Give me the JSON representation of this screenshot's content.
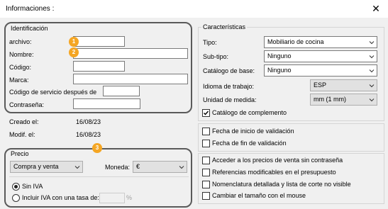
{
  "window": {
    "title": "Informaciones :"
  },
  "identificacion": {
    "legend": "Identificación",
    "fields": {
      "archivo": {
        "label": "archivo:",
        "value": ""
      },
      "nombre": {
        "label": "Nombre:",
        "value": ""
      },
      "codigo": {
        "label": "Código:",
        "value": ""
      },
      "marca": {
        "label": "Marca:",
        "value": ""
      },
      "codigo_servicio": {
        "label": "Código de servicio después de",
        "value": ""
      },
      "contrasena": {
        "label": "Contraseña:",
        "value": ""
      }
    }
  },
  "info": {
    "creado_label": "Creado el:",
    "creado_value": "16/08/23",
    "modif_label": "Modif. el:",
    "modif_value": "16/08/23"
  },
  "precio": {
    "legend": "Precio",
    "tipo_value": "Compra y venta",
    "moneda_label": "Moneda:",
    "moneda_value": "€",
    "sin_iva_label": "Sin IVA",
    "incluir_iva_label": "Incluir IVA con una tasa de:",
    "tasa_value": "",
    "percent": "%"
  },
  "caracteristicas": {
    "legend": "Características",
    "tipo": {
      "label": "Tipo:",
      "value": "Mobiliario de cocina"
    },
    "subtipo": {
      "label": "Sub-tipo:",
      "value": "Ninguno"
    },
    "catalogo_base": {
      "label": "Catálogo de base:",
      "value": "Ninguno"
    },
    "idioma": {
      "label": "Idioma de trabajo:",
      "value": "ESP"
    },
    "unidad": {
      "label": "Unidad de medida:",
      "value": "mm (1 mm)"
    },
    "catalogo_complemento": {
      "label": "Catálogo de complemento",
      "checked": true
    }
  },
  "validacion": {
    "inicio": {
      "label": "Fecha de inicio de validación",
      "checked": false
    },
    "fin": {
      "label": "Fecha de fin de validación",
      "checked": false
    }
  },
  "opciones": [
    {
      "label": "Acceder a los precios de venta sin contraseña",
      "checked": false
    },
    {
      "label": "Referencias modificables en el presupuesto",
      "checked": false
    },
    {
      "label": "Nomenclatura detallada y lista de corte no visible",
      "checked": false
    },
    {
      "label": "Cambiar el tamaño con el mouse",
      "checked": false
    }
  ],
  "badges": [
    "1",
    "2",
    "3"
  ],
  "colors": {
    "badge": "#f5a623",
    "highlight_border": "#5a5a5a"
  },
  "icons": {
    "close": "close-icon",
    "dropdown": "chevron-down-icon",
    "check": "checkmark-icon"
  }
}
